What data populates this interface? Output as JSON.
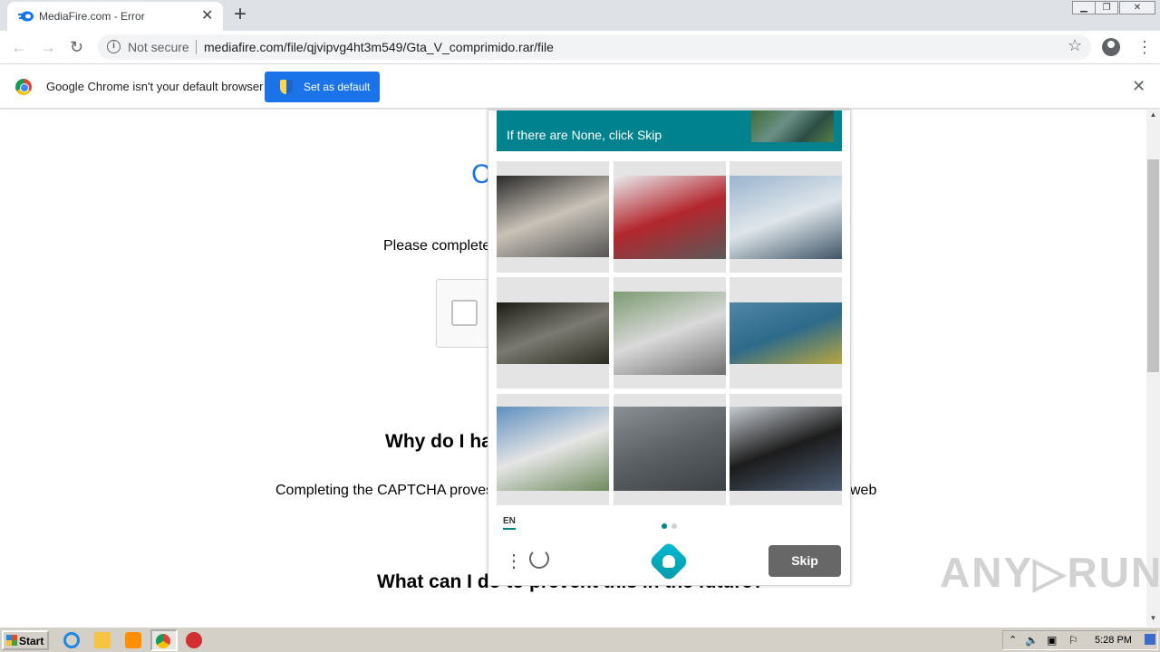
{
  "browser": {
    "tab_title": "MediaFire.com - Error",
    "tab_close": "✕",
    "new_tab": "+",
    "security": "Not secure",
    "url": "mediafire.com/file/qjvipvg4ht3m549/Gta_V_comprimido.rar/file"
  },
  "infobar": {
    "message": "Google Chrome isn't your default browser",
    "button": "Set as default",
    "close": "✕"
  },
  "page": {
    "heading_partial": "C",
    "prompt_partial": "Please complete",
    "why_heading_partial": "Why do I ha",
    "why_text_left": "Completing the CAPTCHA proves",
    "why_text_right": "web",
    "prevent_heading": "What can I do to prevent this in the future?"
  },
  "captcha": {
    "header_text": "If there are None, click Skip",
    "language": "EN",
    "skip_label": "Skip",
    "kebab": "⋮",
    "page_count": 2,
    "current_page": 1,
    "images": [
      {
        "name": "people-at-gas-station",
        "colors": [
          "#2a2a2a",
          "#c9c2b8",
          "#545454"
        ]
      },
      {
        "name": "red-truck",
        "colors": [
          "#e9ecef",
          "#b3262d",
          "#5a5a5a"
        ]
      },
      {
        "name": "boats-in-marina",
        "colors": [
          "#9ab4cf",
          "#dfe6ea",
          "#3e5568"
        ]
      },
      {
        "name": "silver-car-garage",
        "colors": [
          "#1c1c14",
          "#7b7a72",
          "#2b2a20"
        ]
      },
      {
        "name": "white-utility-truck",
        "colors": [
          "#7d9b72",
          "#d9d9d9",
          "#6f6f6f"
        ]
      },
      {
        "name": "kayaker-on-water",
        "colors": [
          "#4f86a8",
          "#2e6a8a",
          "#b8a640"
        ]
      },
      {
        "name": "garbage-truck",
        "colors": [
          "#5e8fbf",
          "#e5e5e5",
          "#6f8a5e"
        ]
      },
      {
        "name": "water-surface",
        "colors": [
          "#8a8f94",
          "#5c6166",
          "#3b4045"
        ]
      },
      {
        "name": "motorboat-on-trailer",
        "colors": [
          "#c6ccd2",
          "#1c1c1c",
          "#4d5d74"
        ]
      }
    ]
  },
  "watermark": "ANY▷RUN",
  "taskbar": {
    "start": "Start",
    "clock": "5:28 PM"
  }
}
